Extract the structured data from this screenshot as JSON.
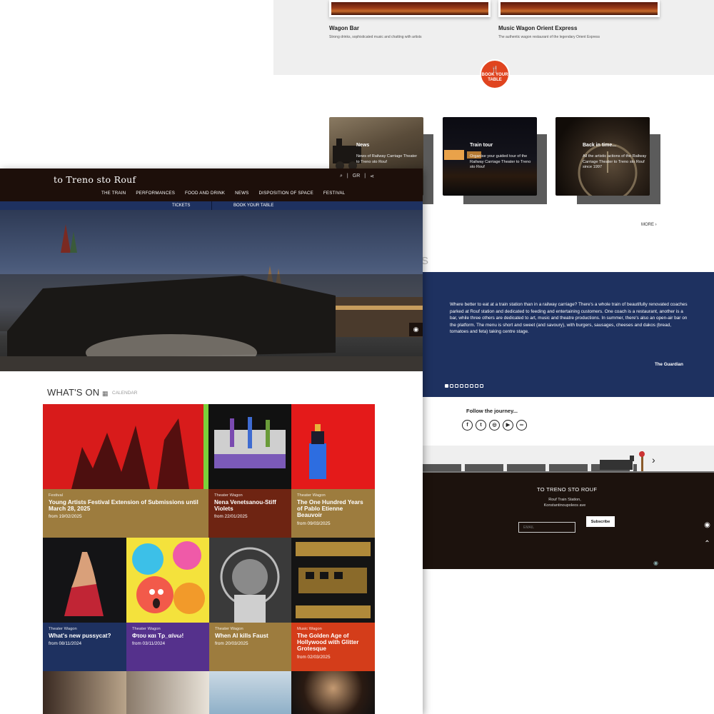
{
  "wagons": [
    {
      "title": "Wagon Bar",
      "subtitle": "Strong drinks, sophisticated music and chatting with artists"
    },
    {
      "title": "Music Wagon Orient Express",
      "subtitle": "The authentic wagon restaurant of the legendary Orient Express"
    }
  ],
  "book_badge": {
    "line1": "BOOK YOUR",
    "line2": "TABLE"
  },
  "cards": [
    {
      "title": "News",
      "text": "News of Railway Carriage Theater to Treno sto Rouf"
    },
    {
      "title": "Train tour",
      "text": "Organise your guided tour of the Railway Carriage Theater to Treno sto Rouf"
    },
    {
      "title": "Back in time...",
      "text": "All the artistic actions of the Railway Carriage Theater to Treno sto Rouf since 1997"
    }
  ],
  "more_label": "MORE",
  "quote": {
    "text": "Where better to eat at a train station than in a railway carriage? There's a whole train of beautifully renovated coaches parked at Rouf station and dedicated to feeding and entertaining customers. One coach is a restaurant, another is a bar, while three others are dedicated to art, music and theatre productions. In summer, there's also an open-air bar on the platform. The menu is short and sweet (and savoury), with burgers, sausages, cheeses and dakos (bread, tomatoes and feta) taking centre stage.",
    "source": "The Guardian",
    "slides": 8,
    "active_slide": 0
  },
  "follow": {
    "title": "Follow the journey...",
    "icons": [
      "facebook-icon",
      "twitter-icon",
      "instagram-icon",
      "youtube-icon",
      "tripadvisor-icon"
    ]
  },
  "footer": {
    "title": "TO TRENO STO ROUF",
    "address_line1": "Rouf Train Station,",
    "address_line2": "Konstantinoupoleos ave",
    "email_placeholder": "EMAIL",
    "subscribe_label": "Subscribe"
  },
  "header": {
    "logo": "to Treno sto Rouf",
    "lang": "GR",
    "nav": [
      "THE TRAIN",
      "PERFORMANCES",
      "FOOD AND DRINK",
      "NEWS",
      "DISPOSITION OF SPACE",
      "FESTIVAL"
    ],
    "tickets": "TICKETS",
    "book_table": "BOOK YOUR TABLE"
  },
  "whats_on": {
    "title": "WHAT'S ON",
    "calendar": "CALENDAR"
  },
  "events": [
    {
      "category": "Festival",
      "title": "Young Artists Festival Extension of Submissions until March 28, 2025",
      "date": "from 19/02/2025",
      "color": "#9d7c3e"
    },
    {
      "category": "Theater Wagon",
      "title": "Nena Venetsanou-Stiff Violets",
      "date": "from 22/01/2025",
      "color": "#6e2412"
    },
    {
      "category": "Theater Wagon",
      "title": "The One Hundred Years of Pablo Etienne Beauvoir",
      "date": "from 09/03/2025",
      "color": "#9d7c3e"
    },
    {
      "category": "Theater Wagon",
      "title": "What's new pussycat?",
      "date": "from 08/11/2024",
      "color": "#1e3160"
    },
    {
      "category": "Theater Wagon",
      "title": "Φτου και Τρ_αίνω!",
      "date": "from 03/11/2024",
      "color": "#55318c"
    },
    {
      "category": "Theater Wagon",
      "title": "When AI kills Faust",
      "date": "from 20/03/2025",
      "color": "#9d7c3e"
    },
    {
      "category": "Music Wagon",
      "title": "The Golden Age of Hollywood with Glitter Grotesque",
      "date": "from 02/03/2025",
      "color": "#d43d1a"
    }
  ]
}
